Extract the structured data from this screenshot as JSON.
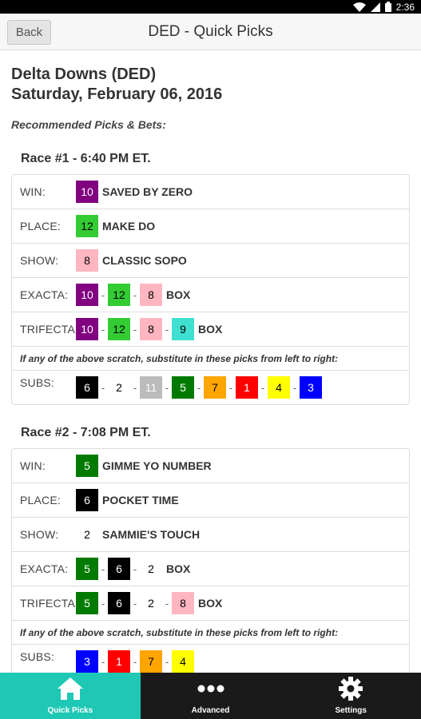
{
  "status_bar": {
    "time": "2:36"
  },
  "header": {
    "back_label": "Back",
    "title": "DED - Quick Picks"
  },
  "track": {
    "name": "Delta Downs (DED)",
    "date": "Saturday, February 06, 2016"
  },
  "recommended_label": "Recommended Picks & Bets:",
  "races": [
    {
      "title": "Race #1 - 6:40 PM ET.",
      "win": {
        "label": "WIN:",
        "num": "10",
        "bg": "#800080",
        "fg": "#ffffff",
        "horse": "SAVED BY ZERO"
      },
      "place": {
        "label": "PLACE:",
        "num": "12",
        "bg": "#33cc33",
        "fg": "#000000",
        "horse": "MAKE DO"
      },
      "show": {
        "label": "SHOW:",
        "num": "8",
        "bg": "#ffb6c1",
        "fg": "#000000",
        "horse": "CLASSIC SOPO"
      },
      "exacta": {
        "label": "EXACTA:",
        "nums": [
          {
            "num": "10",
            "bg": "#800080",
            "fg": "#ffffff"
          },
          {
            "num": "12",
            "bg": "#33cc33",
            "fg": "#000000"
          },
          {
            "num": "8",
            "bg": "#ffb6c1",
            "fg": "#000000"
          }
        ],
        "box": "BOX"
      },
      "trifecta": {
        "label": "TRIFECTA:",
        "nums": [
          {
            "num": "10",
            "bg": "#800080",
            "fg": "#ffffff"
          },
          {
            "num": "12",
            "bg": "#33cc33",
            "fg": "#000000"
          },
          {
            "num": "8",
            "bg": "#ffb6c1",
            "fg": "#000000"
          },
          {
            "num": "9",
            "bg": "#40e0d0",
            "fg": "#000000"
          }
        ],
        "box": "BOX"
      },
      "scratch_note": "If any of the above scratch, substitute in these picks from left to right:",
      "subs": {
        "label": "SUBS:",
        "nums": [
          {
            "num": "6",
            "bg": "#000000",
            "fg": "#ffffff"
          },
          {
            "num": "2",
            "bg": "#ffffff",
            "fg": "#000000"
          },
          {
            "num": "11",
            "bg": "#bbbbbb",
            "fg": "#ffffff"
          },
          {
            "num": "5",
            "bg": "#007a00",
            "fg": "#ffffff"
          },
          {
            "num": "7",
            "bg": "#ffa500",
            "fg": "#000000"
          },
          {
            "num": "1",
            "bg": "#ff0000",
            "fg": "#ffffff"
          },
          {
            "num": "4",
            "bg": "#ffff00",
            "fg": "#000000"
          },
          {
            "num": "3",
            "bg": "#0000ff",
            "fg": "#ffffff"
          }
        ]
      }
    },
    {
      "title": "Race #2 - 7:08 PM ET.",
      "win": {
        "label": "WIN:",
        "num": "5",
        "bg": "#007a00",
        "fg": "#ffffff",
        "horse": "GIMME YO NUMBER"
      },
      "place": {
        "label": "PLACE:",
        "num": "6",
        "bg": "#000000",
        "fg": "#ffffff",
        "horse": "POCKET TIME"
      },
      "show": {
        "label": "SHOW:",
        "num": "2",
        "bg": "#ffffff",
        "fg": "#000000",
        "horse": "SAMMIE'S TOUCH"
      },
      "exacta": {
        "label": "EXACTA:",
        "nums": [
          {
            "num": "5",
            "bg": "#007a00",
            "fg": "#ffffff"
          },
          {
            "num": "6",
            "bg": "#000000",
            "fg": "#ffffff"
          },
          {
            "num": "2",
            "bg": "#ffffff",
            "fg": "#000000"
          }
        ],
        "box": "BOX"
      },
      "trifecta": {
        "label": "TRIFECTA:",
        "nums": [
          {
            "num": "5",
            "bg": "#007a00",
            "fg": "#ffffff"
          },
          {
            "num": "6",
            "bg": "#000000",
            "fg": "#ffffff"
          },
          {
            "num": "2",
            "bg": "#ffffff",
            "fg": "#000000"
          },
          {
            "num": "8",
            "bg": "#ffb6c1",
            "fg": "#000000"
          }
        ],
        "box": "BOX"
      },
      "scratch_note": "If any of the above scratch, substitute in these picks from left to right:",
      "subs": {
        "label": "SUBS:",
        "nums": [
          {
            "num": "3",
            "bg": "#0000ff",
            "fg": "#ffffff"
          },
          {
            "num": "1",
            "bg": "#ff0000",
            "fg": "#ffffff"
          },
          {
            "num": "7",
            "bg": "#ffa500",
            "fg": "#000000"
          },
          {
            "num": "4",
            "bg": "#ffff00",
            "fg": "#000000"
          }
        ]
      }
    }
  ],
  "tabs": [
    {
      "label": "Quick Picks",
      "icon": "home-icon",
      "active": true
    },
    {
      "label": "Advanced",
      "icon": "more-dots-icon",
      "active": false
    },
    {
      "label": "Settings",
      "icon": "gear-icon",
      "active": false
    }
  ]
}
